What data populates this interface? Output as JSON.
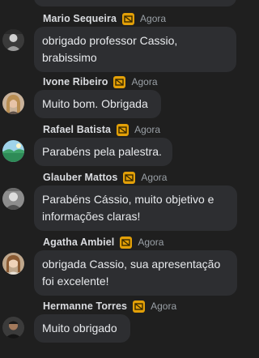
{
  "messages": [
    {
      "author": "Mario Sequeira",
      "time": "Agora",
      "text": [
        "obrigado professor Cassio,",
        "brabissimo"
      ],
      "avatar": "avatar-dark-photo"
    },
    {
      "author": "Ivone Ribeiro",
      "time": "Agora",
      "text": [
        "Muito bom. Obrigada"
      ],
      "avatar": "avatar-woman-blonde"
    },
    {
      "author": "Rafael Batista",
      "time": "Agora",
      "text": [
        "Parabéns pela palestra."
      ],
      "avatar": "avatar-landscape"
    },
    {
      "author": "Glauber Mattos",
      "time": "Agora",
      "text": [
        "Parabéns Cássio, muito objetivo e",
        "informações claras!"
      ],
      "avatar": "avatar-man-grey"
    },
    {
      "author": "Agatha Ambiel",
      "time": "Agora",
      "text": [
        "obrigada Cassio, sua apresentação",
        "foi excelente!"
      ],
      "avatar": "avatar-woman-brown"
    },
    {
      "author": "Hermanne Torres",
      "time": "Agora",
      "text": [
        "Muito obrigado"
      ],
      "avatar": "avatar-man-dark"
    }
  ],
  "colors": {
    "background": "#1f1f1f",
    "bubble": "#2d2e31",
    "badge": "#e3a008"
  }
}
